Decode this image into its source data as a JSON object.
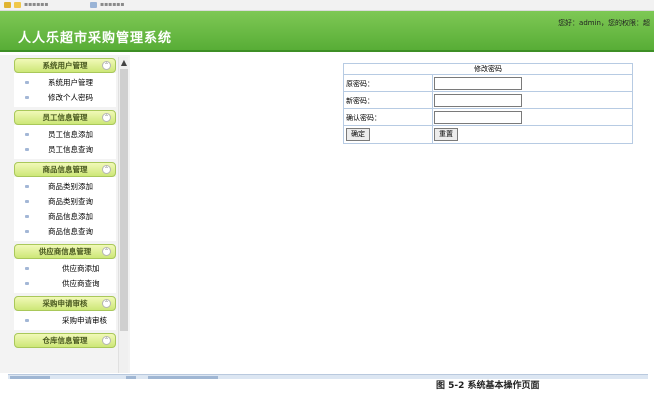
{
  "header": {
    "app_title": "人人乐超市采购管理系统",
    "user_info": "您好：admin，您的权限：超"
  },
  "sidebar": {
    "groups": [
      {
        "title": "系统用户管理",
        "items": [
          "系统用户管理",
          "修改个人密码"
        ]
      },
      {
        "title": "员工信息管理",
        "items": [
          "员工信息添加",
          "员工信息查询"
        ]
      },
      {
        "title": "商品信息管理",
        "items": [
          "商品类别添加",
          "商品类别查询",
          "商品信息添加",
          "商品信息查询"
        ]
      },
      {
        "title": "供应商信息管理",
        "items": [
          "供应商添加",
          "供应商查询"
        ]
      },
      {
        "title": "采购申请审核",
        "items": [
          "采购申请审核"
        ]
      },
      {
        "title": "仓库信息管理",
        "items": []
      }
    ]
  },
  "form": {
    "title": "修改密码",
    "old_password_label": "原密码：",
    "new_password_label": "新密码：",
    "confirm_password_label": "确认密码：",
    "old_password_value": "",
    "new_password_value": "",
    "confirm_password_value": "",
    "submit_label": "确定",
    "reset_label": "重置"
  },
  "caption": "图 5-2 系统基本操作页面"
}
